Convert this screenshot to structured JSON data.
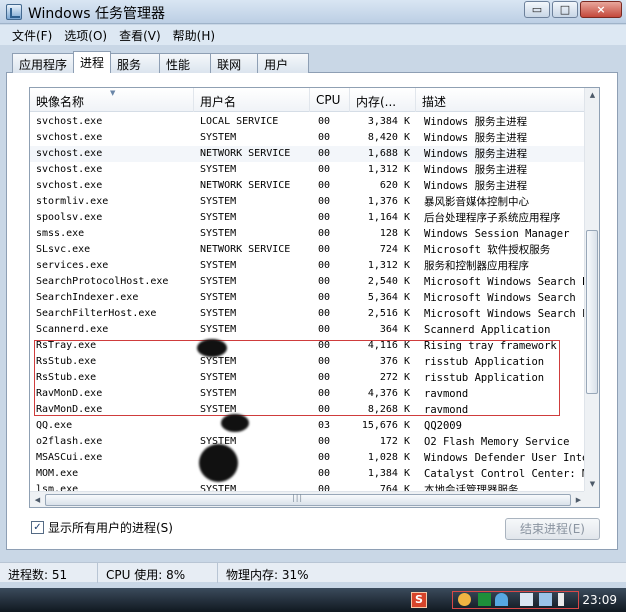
{
  "window": {
    "title": "Windows 任务管理器",
    "minimize_glyph": "▭",
    "maximize_glyph": "□",
    "close_glyph": "×"
  },
  "menu": [
    "文件(F)",
    "选项(O)",
    "查看(V)",
    "帮助(H)"
  ],
  "tabs": [
    "应用程序",
    "进程",
    "服务",
    "性能",
    "联网",
    "用户"
  ],
  "active_tab": "进程",
  "columns": [
    "映像名称",
    "用户名",
    "CPU",
    "内存(...",
    "描述"
  ],
  "processes": [
    {
      "name": "svchost.exe",
      "user": "LOCAL SERVICE",
      "cpu": "00",
      "memory": "3,384 K",
      "description": "Windows 服务主进程"
    },
    {
      "name": "svchost.exe",
      "user": "SYSTEM",
      "cpu": "00",
      "memory": "8,420 K",
      "description": "Windows 服务主进程"
    },
    {
      "name": "svchost.exe",
      "user": "NETWORK SERVICE",
      "cpu": "00",
      "memory": "1,688 K",
      "description": "Windows 服务主进程"
    },
    {
      "name": "svchost.exe",
      "user": "SYSTEM",
      "cpu": "00",
      "memory": "1,312 K",
      "description": "Windows 服务主进程"
    },
    {
      "name": "svchost.exe",
      "user": "NETWORK SERVICE",
      "cpu": "00",
      "memory": "620 K",
      "description": "Windows 服务主进程"
    },
    {
      "name": "stormliv.exe",
      "user": "SYSTEM",
      "cpu": "00",
      "memory": "1,376 K",
      "description": "暴风影音媒体控制中心"
    },
    {
      "name": "spoolsv.exe",
      "user": "SYSTEM",
      "cpu": "00",
      "memory": "1,164 K",
      "description": "后台处理程序子系统应用程序"
    },
    {
      "name": "smss.exe",
      "user": "SYSTEM",
      "cpu": "00",
      "memory": "128 K",
      "description": "Windows Session Manager"
    },
    {
      "name": "SLsvc.exe",
      "user": "NETWORK SERVICE",
      "cpu": "00",
      "memory": "724 K",
      "description": "Microsoft 软件授权服务"
    },
    {
      "name": "services.exe",
      "user": "SYSTEM",
      "cpu": "00",
      "memory": "1,312 K",
      "description": "服务和控制器应用程序"
    },
    {
      "name": "SearchProtocolHost.exe",
      "user": "SYSTEM",
      "cpu": "00",
      "memory": "2,540 K",
      "description": "Microsoft Windows Search P..."
    },
    {
      "name": "SearchIndexer.exe",
      "user": "SYSTEM",
      "cpu": "00",
      "memory": "5,364 K",
      "description": "Microsoft Windows Search ..."
    },
    {
      "name": "SearchFilterHost.exe",
      "user": "SYSTEM",
      "cpu": "00",
      "memory": "2,516 K",
      "description": "Microsoft Windows Search F..."
    },
    {
      "name": "Scannerd.exe",
      "user": "SYSTEM",
      "cpu": "00",
      "memory": "364 K",
      "description": "Scannerd Application"
    },
    {
      "name": "RsTray.exe",
      "user": "",
      "cpu": "00",
      "memory": "4,116 K",
      "description": "Rising tray framework"
    },
    {
      "name": "RsStub.exe",
      "user": "SYSTEM",
      "cpu": "00",
      "memory": "376 K",
      "description": "risstub Application"
    },
    {
      "name": "RsStub.exe",
      "user": "SYSTEM",
      "cpu": "00",
      "memory": "272 K",
      "description": "risstub Application"
    },
    {
      "name": "RavMonD.exe",
      "user": "SYSTEM",
      "cpu": "00",
      "memory": "4,376 K",
      "description": "ravmond"
    },
    {
      "name": "RavMonD.exe",
      "user": "SYSTEM",
      "cpu": "00",
      "memory": "8,268 K",
      "description": "ravmond"
    },
    {
      "name": "QQ.exe",
      "user": "",
      "cpu": "03",
      "memory": "15,676 K",
      "description": "QQ2009"
    },
    {
      "name": "o2flash.exe",
      "user": "SYSTEM",
      "cpu": "00",
      "memory": "172 K",
      "description": "O2 Flash Memory Service"
    },
    {
      "name": "MSASCui.exe",
      "user": "",
      "cpu": "00",
      "memory": "1,028 K",
      "description": "Windows Defender User Inte..."
    },
    {
      "name": "MOM.exe",
      "user": "",
      "cpu": "00",
      "memory": "1,384 K",
      "description": "Catalyst Control Center: M..."
    },
    {
      "name": "lsm.exe",
      "user": "SYSTEM",
      "cpu": "00",
      "memory": "764 K",
      "description": "本地会话管理器服务"
    }
  ],
  "selected_row": 2,
  "show_all_users": {
    "label": "显示所有用户的进程(S)",
    "checked": true
  },
  "end_process_button": "结束进程(E)",
  "status": {
    "processes": "进程数: 51",
    "cpu": "CPU 使用: 8%",
    "memory": "物理内存: 31%"
  },
  "taskbar": {
    "tray_app_label": "S",
    "clock": "23:09"
  }
}
